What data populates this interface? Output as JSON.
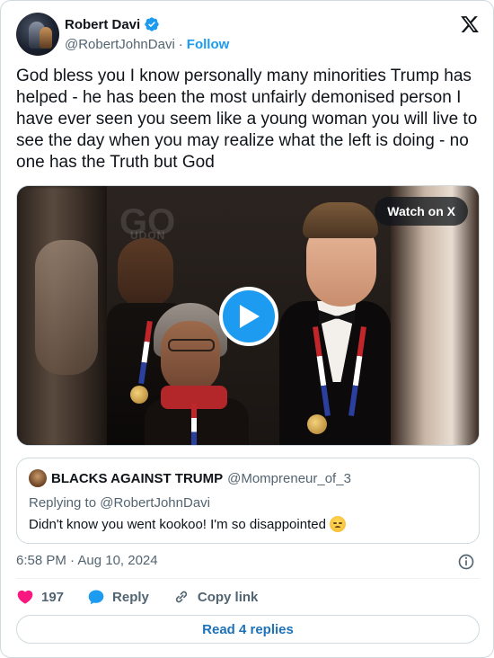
{
  "author": {
    "name": "Robert Davi",
    "handle": "@RobertJohnDavi",
    "separator": "·",
    "follow_label": "Follow",
    "verified": true
  },
  "tweet": {
    "text": "God bless you I know personally many minorities Trump has helped - he has been the most unfairly demonised person I have ever seen you seem like a young woman you will live to see the day when you may realize what the left is doing - no one has the Truth but God"
  },
  "media": {
    "watch_label": "Watch on X",
    "background_text": "GO",
    "background_subtext": "UDON"
  },
  "quote": {
    "name": "BLACKS AGAINST TRUMP",
    "handle": "@Mompreneur_of_3",
    "replying_label": "Replying to @RobertJohnDavi",
    "text": "Didn't know you went kookoo! I'm so disappointed"
  },
  "timestamp": "6:58 PM · Aug 10, 2024",
  "actions": {
    "like_count": "197",
    "reply_label": "Reply",
    "copy_link_label": "Copy link"
  },
  "read_replies_label": "Read 4 replies",
  "colors": {
    "accent": "#1d9bf0",
    "like": "#f91880",
    "text": "#0f1419",
    "muted": "#536471",
    "border": "#cfd9de"
  },
  "icons": [
    "verified-badge-icon",
    "x-logo-icon",
    "play-icon",
    "info-icon",
    "heart-icon",
    "reply-icon",
    "link-icon",
    "disappointed-face-icon"
  ]
}
